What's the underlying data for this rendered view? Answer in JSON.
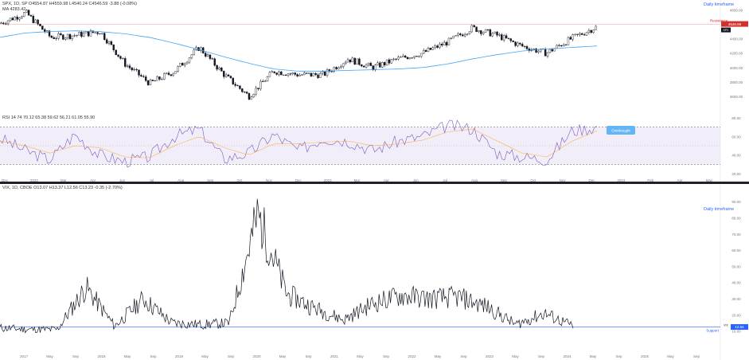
{
  "top": {
    "legend_line1": "SPX, 1D, SP  O4554.87  H4559.98  L4540.24  C4546.59  -3.88 (-0.08%)",
    "legend_line2": "MA  4283.42",
    "link_label": "Daily timeframe",
    "resistance_label": "Resistance",
    "price_badge": "4546.59",
    "series_tag": "SPX",
    "y_ticks": [
      "4800.00",
      "4600.00",
      "4400.00",
      "4200.00",
      "4000.00",
      "3800.00",
      "3600.00"
    ],
    "x_ticks": [
      "Dec",
      "2022",
      "Mar",
      "Apr",
      "Jun",
      "Jul",
      "Aug",
      "Sep",
      "Oct",
      "Nov",
      "Dec",
      "2023",
      "Mar",
      "Apr",
      "Jun",
      "Jul",
      "Aug",
      "Sep",
      "Oct",
      "Nov",
      "Dec",
      "2024",
      "Feb",
      "Apr",
      "May"
    ]
  },
  "rsi": {
    "legend": "RSI  14  74  70.12  65.38  59.62  56.21  61.05  55.90",
    "y_ticks": [
      "80.00",
      "60.00",
      "40.00",
      "20.00"
    ],
    "overbought_label": "Overbought"
  },
  "bottom": {
    "legend": "VIX, 1D, CBOE  O13.07  H13.37  L12.56  C13.23  -0.35 (-2.70%)",
    "link_label": "Daily timeframe",
    "support_label": "Support",
    "price_badge": "12.54",
    "series_tag": "VIX",
    "y_ticks": [
      "90.00",
      "80.00",
      "70.00",
      "60.00",
      "50.00",
      "40.00",
      "30.00",
      "20.00",
      "10.00"
    ],
    "x_ticks": [
      "2017",
      "May",
      "Sep",
      "2018",
      "May",
      "Sep",
      "2019",
      "May",
      "Sep",
      "2020",
      "May",
      "Sep",
      "2021",
      "May",
      "Sep",
      "2022",
      "May",
      "Sep",
      "2023",
      "May",
      "Sep",
      "2024",
      "May",
      "Sep",
      "2025",
      "May",
      "Sep"
    ]
  },
  "chart_data": [
    {
      "type": "line",
      "title": "SPX, 1D, SP",
      "ylim": [
        3500,
        4850
      ],
      "resistance": 4600,
      "x": [
        "2021-12",
        "2022-01",
        "2022-02",
        "2022-03",
        "2022-04",
        "2022-05",
        "2022-06",
        "2022-07",
        "2022-08",
        "2022-09",
        "2022-10",
        "2022-11",
        "2022-12",
        "2023-01",
        "2023-02",
        "2023-03",
        "2023-04",
        "2023-05",
        "2023-06",
        "2023-07",
        "2023-08",
        "2023-09",
        "2023-10",
        "2023-11",
        "2023-12"
      ],
      "series": [
        {
          "name": "SPX",
          "values": [
            4620,
            4760,
            4420,
            4450,
            4500,
            4050,
            3780,
            3950,
            4280,
            3900,
            3600,
            3950,
            3900,
            3900,
            4120,
            4000,
            4120,
            4200,
            4350,
            4550,
            4450,
            4300,
            4200,
            4400,
            4560
          ]
        },
        {
          "name": "MA",
          "values": [
            4420,
            4480,
            4500,
            4510,
            4500,
            4470,
            4420,
            4340,
            4250,
            4150,
            4060,
            3980,
            3950,
            3950,
            3960,
            3970,
            3980,
            4000,
            4050,
            4120,
            4180,
            4230,
            4260,
            4280,
            4300
          ]
        }
      ]
    },
    {
      "type": "line",
      "title": "RSI 14",
      "ylim": [
        20,
        80
      ],
      "overbought": 70,
      "oversold": 30,
      "x": [
        "2021-12",
        "2022-01",
        "2022-02",
        "2022-03",
        "2022-04",
        "2022-05",
        "2022-06",
        "2022-07",
        "2022-08",
        "2022-09",
        "2022-10",
        "2022-11",
        "2022-12",
        "2023-01",
        "2023-02",
        "2023-03",
        "2023-04",
        "2023-05",
        "2023-06",
        "2023-07",
        "2023-08",
        "2023-09",
        "2023-10",
        "2023-11",
        "2023-12"
      ],
      "series": [
        {
          "name": "RSI",
          "values": [
            58,
            45,
            35,
            62,
            40,
            33,
            38,
            60,
            68,
            36,
            42,
            62,
            45,
            58,
            55,
            45,
            55,
            60,
            72,
            68,
            42,
            38,
            35,
            66,
            70
          ]
        },
        {
          "name": "RSI MA",
          "values": [
            55,
            50,
            42,
            50,
            48,
            38,
            37,
            50,
            60,
            48,
            40,
            52,
            52,
            54,
            55,
            50,
            52,
            56,
            65,
            68,
            55,
            42,
            38,
            55,
            66
          ]
        }
      ]
    },
    {
      "type": "line",
      "title": "VIX, 1D, CBOE",
      "ylim": [
        0,
        95
      ],
      "support": 12.54,
      "x": [
        "2017-01",
        "2017-07",
        "2018-01",
        "2018-02",
        "2018-07",
        "2018-12",
        "2019-06",
        "2019-12",
        "2020-02",
        "2020-03",
        "2020-06",
        "2020-12",
        "2021-06",
        "2021-12",
        "2022-03",
        "2022-06",
        "2022-10",
        "2023-03",
        "2023-06",
        "2023-10",
        "2023-12"
      ],
      "series": [
        {
          "name": "VIX",
          "values": [
            12,
            11,
            11,
            37,
            13,
            30,
            15,
            14,
            15,
            82,
            33,
            24,
            17,
            27,
            32,
            30,
            31,
            25,
            14,
            21,
            13
          ]
        }
      ]
    }
  ]
}
